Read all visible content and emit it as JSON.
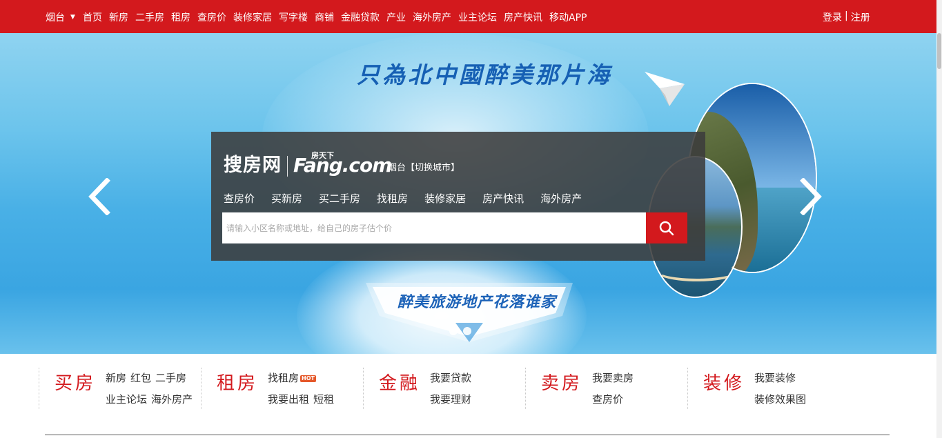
{
  "topnav": {
    "city": "烟台",
    "items": [
      "首页",
      "新房",
      "二手房",
      "租房",
      "查房价",
      "装修家居",
      "写字楼",
      "商铺",
      "金融贷款",
      "产业",
      "海外房产",
      "业主论坛",
      "房产快讯",
      "移动APP"
    ],
    "login": "登录",
    "divider": "|",
    "register": "注册"
  },
  "banner": {
    "slogan": "只為北中國醉美那片海",
    "ribbon": "醉美旅游地产花落谁家"
  },
  "panel": {
    "logo_cn": "搜房网",
    "logo_en": "Fang.com",
    "logo_tiny": "房天下",
    "city_switch": "烟台【切换城市】",
    "tabs": [
      "查房价",
      "买新房",
      "买二手房",
      "找租房",
      "装修家居",
      "房产快讯",
      "海外房产"
    ],
    "search_placeholder": "请输入小区名称或地址，给自己的房子估个价"
  },
  "categories": [
    {
      "title": "买房",
      "row1": [
        "新房",
        "红包",
        "二手房"
      ],
      "row2": [
        "业主论坛",
        "海外房产"
      ]
    },
    {
      "title": "租房",
      "row1": [
        "找租房"
      ],
      "hot": "HOT",
      "row2": [
        "我要出租",
        "短租"
      ]
    },
    {
      "title": "金融",
      "row1": [
        "我要贷款"
      ],
      "row2": [
        "我要理财"
      ]
    },
    {
      "title": "卖房",
      "row1": [
        "我要卖房"
      ],
      "row2": [
        "查房价"
      ]
    },
    {
      "title": "装修",
      "row1": [
        "我要装修"
      ],
      "row2": [
        "装修效果图"
      ]
    }
  ],
  "colors": {
    "brand_red": "#d3191d"
  }
}
